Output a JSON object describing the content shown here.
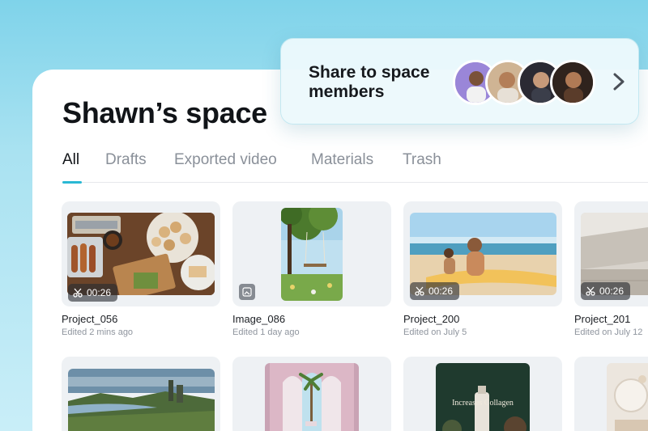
{
  "space": {
    "title": "Shawn’s space"
  },
  "tabs": [
    {
      "label": "All",
      "active": true
    },
    {
      "label": "Drafts",
      "active": false
    },
    {
      "label": "Exported video",
      "active": false
    },
    {
      "label": "Materials",
      "active": false
    },
    {
      "label": "Trash",
      "active": false
    }
  ],
  "share": {
    "label": "Share to space members"
  },
  "cards_row1": [
    {
      "name": "Project_056",
      "meta": "Edited 2 mins ago",
      "duration": "00:26",
      "kind": "video"
    },
    {
      "name": "Image_086",
      "meta": "Edited 1 day ago",
      "duration": "",
      "kind": "image"
    },
    {
      "name": "Project_200",
      "meta": "Edited on July 5",
      "duration": "00:26",
      "kind": "video"
    },
    {
      "name": "Project_201",
      "meta": "Edited on July 12",
      "duration": "00:26",
      "kind": "video"
    }
  ],
  "cards_row2": [
    {
      "kind": "landscape"
    },
    {
      "kind": "arches"
    },
    {
      "kind": "product",
      "text": "Increases Collagen"
    },
    {
      "kind": "interior"
    }
  ],
  "colors": {
    "accent": "#2ab8d4",
    "background": "#8fd8ee"
  },
  "icons": {
    "video_badge": "scissors-icon",
    "image_badge": "image-icon",
    "share_arrow": "chevron-right-icon"
  }
}
